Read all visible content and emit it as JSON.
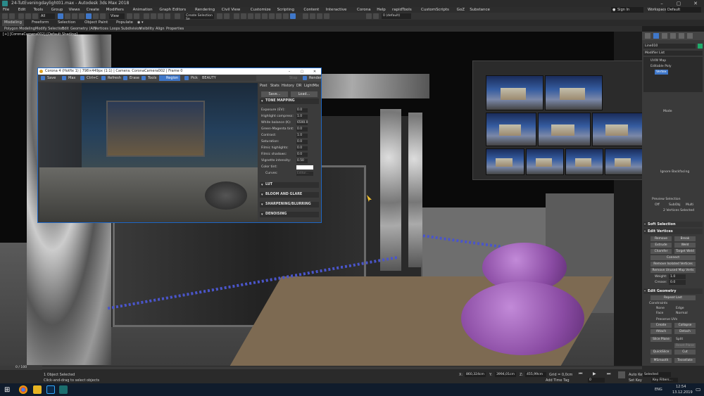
{
  "window": {
    "title": "24-TutEveningdaylight01.max - Autodesk 3ds Max 2018",
    "min": "–",
    "max": "▢",
    "close": "✕",
    "signin": "Sign In",
    "workspaces_label": "Workspaces:",
    "workspaces_value": "Default"
  },
  "menu": [
    "File",
    "Edit",
    "Tools",
    "Group",
    "Views",
    "Create",
    "Modifiers",
    "Animation",
    "Graph Editors",
    "Rendering",
    "Civil View",
    "Customize",
    "Scripting",
    "Content",
    "Interactive",
    "Corona",
    "Help",
    "rapidTools",
    "CustomScripts",
    "GoZ",
    "Substance"
  ],
  "toolbar": {
    "filter": "All",
    "view": "View",
    "selection_set": "Create Selection Se",
    "layer": "0 (default)"
  },
  "ribbon": {
    "tabs": [
      "Modeling",
      "Freeform",
      "Selection",
      "Object Paint",
      "Populate"
    ],
    "row2": [
      "Polygon Modeling",
      "Modify Selection",
      "Edit",
      "Geometry (All)",
      "Vertices",
      "Loops",
      "Subdivision",
      "Visibility",
      "Align",
      "Properties"
    ]
  },
  "viewport": {
    "label": "[+] [CoronaCamera002] [Default Shading]"
  },
  "corona_vfb": {
    "title": "Corona 4 (Hotfix 1) | 798×449px (1:1) | Camera: CoronaCamera002 | Frame 0",
    "buttons": {
      "save": "Save",
      "max": "Max",
      "ctrlc": "Ctrl+C",
      "refresh": "Refresh",
      "erase": "Erase",
      "tools": "Tools",
      "region": "Region",
      "pick": "Pick",
      "beauty": "BEAUTY",
      "stop": "Stop",
      "render": "Render"
    },
    "tabs": [
      "Post",
      "Stats",
      "History",
      "DR",
      "LightMix"
    ],
    "save_btn": "Save...",
    "load_btn": "Load...",
    "tone_mapping_title": "TONE MAPPING",
    "tone_mapping": [
      {
        "label": "Exposure (EV):",
        "value": "0.0"
      },
      {
        "label": "Highlight compress:",
        "value": "1.0"
      },
      {
        "label": "White balance (K):",
        "value": "6500.0"
      },
      {
        "label": "Green-Magenta tint:",
        "value": "0.0"
      },
      {
        "label": "Contrast:",
        "value": "1.0"
      },
      {
        "label": "Saturation:",
        "value": "0.0"
      },
      {
        "label": "Filmic highlights:",
        "value": "0.0"
      },
      {
        "label": "Filmic shadows:",
        "value": "0.0"
      },
      {
        "label": "Vignette intensity:",
        "value": "0.50"
      }
    ],
    "color_tint": "Color tint:",
    "curves": "Curves:",
    "curves_btn": "Editor...",
    "sections": [
      "LUT",
      "BLOOM AND GLARE",
      "SHARPENING/BLURRING",
      "DENOISING"
    ]
  },
  "command_panel": {
    "object_name": "Line010",
    "modifier_list": "Modifier List",
    "stack": [
      "UVW Map",
      "Editable Poly",
      "Vertex"
    ],
    "sections": {
      "selection_mode": "Mode",
      "by_vertex": "Vertex",
      "ignore_backfacing": "Ignore Backfacing",
      "preview_selection": "Preview Selection",
      "preview_opts": [
        "Off",
        "SubObj",
        "Multi"
      ],
      "vertices_selected": "2 Vertices Selected",
      "soft_selection": "Soft Selection",
      "edit_vertices": "Edit Vertices",
      "edit_geometry": "Edit Geometry"
    },
    "edit_vertices_buttons": [
      "Remove",
      "Break",
      "Extrude",
      "Weld",
      "Chamfer",
      "Target Weld",
      "Connect",
      "Remove Isolated Vertices",
      "Remove Unused Map Verts"
    ],
    "weight_label": "Weight:",
    "weight_value": "1.0",
    "crease_label": "Crease:",
    "crease_value": "0.0",
    "edit_geometry_buttons": [
      "Repeat Last",
      "Create",
      "Collapse",
      "Attach",
      "Detach",
      "Slice Plane",
      "Split",
      "Reset Plane",
      "QuickSlice",
      "Cut",
      "MSmooth",
      "Tessellate"
    ],
    "constraints_label": "Constraints",
    "constraints": [
      "None",
      "Edge",
      "Face",
      "Normal"
    ],
    "preserve_uvs": "Preserve UVs"
  },
  "status": {
    "frame": "0 / 100",
    "selected": "1 Object Selected",
    "hint": "Click-and-drag to select objects",
    "x_label": "X:",
    "x": "860,324cm",
    "y_label": "Y:",
    "y": "3994,01cm",
    "z_label": "Z:",
    "z": "455,99cm",
    "grid": "Grid = 0,0cm",
    "add_time_tag": "Add Time Tag",
    "auto_key": "Auto Key",
    "set_key": "Set Key",
    "selected_dd": "Selected",
    "key_filters": "Key Filters...",
    "frame_field": "0"
  },
  "taskbar": {
    "time": "12:54",
    "date": "13.12.2019",
    "lang": "ENG"
  },
  "colors": {
    "accent": "#3f77c9",
    "beanbag": "#9b5bb5",
    "titlebar": "#2b2b2b"
  }
}
